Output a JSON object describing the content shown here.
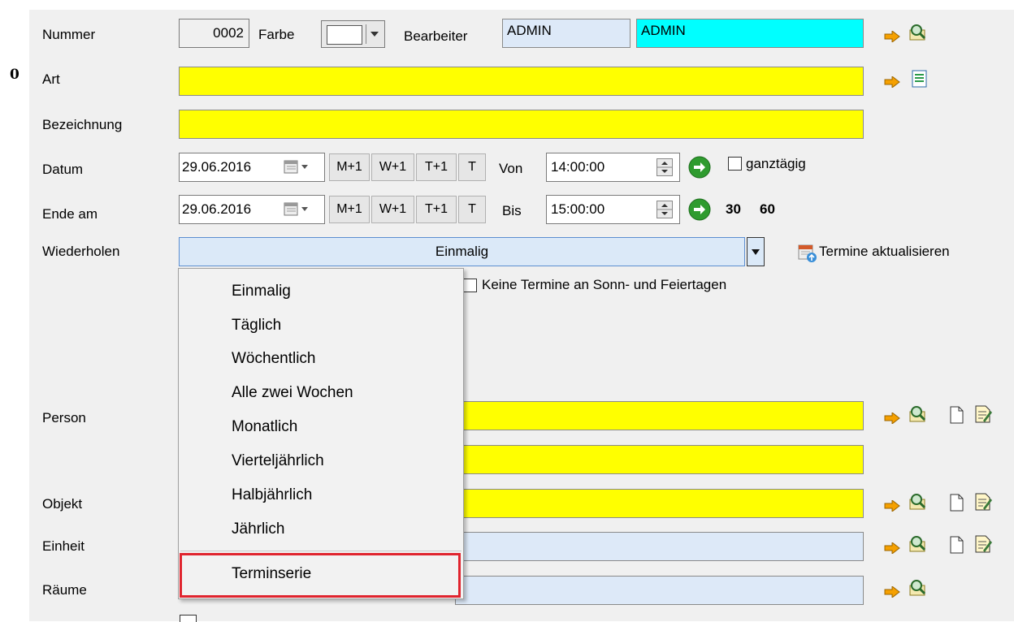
{
  "margin_marker": "0",
  "labels": {
    "nummer": "Nummer",
    "farbe": "Farbe",
    "bearbeiter": "Bearbeiter",
    "art": "Art",
    "bezeichnung": "Bezeichnung",
    "datum": "Datum",
    "ende_am": "Ende am",
    "wiederholen": "Wiederholen",
    "person": "Person",
    "objekt": "Objekt",
    "einheit": "Einheit",
    "raeume": "Räume",
    "von": "Von",
    "bis": "Bis"
  },
  "fields": {
    "nummer": "0002",
    "bearbeiter_code": "ADMIN",
    "bearbeiter_name": "ADMIN",
    "art": "",
    "bezeichnung": "",
    "datum": "29.06.2016",
    "ende_am": "29.06.2016",
    "von_time": "14:00:00",
    "bis_time": "15:00:00",
    "wiederholen": "Einmalig"
  },
  "date_buttons": [
    "M+1",
    "W+1",
    "T+1",
    "T"
  ],
  "ganztaegig_label": "ganztägig",
  "duration_30": "30",
  "duration_60": "60",
  "termine_aktualisieren": "Termine aktualisieren",
  "keine_termine_label": "Keine Termine an Sonn- und Feiertagen",
  "dropdown": {
    "items": [
      "Einmalig",
      "Täglich",
      "Wöchentlich",
      "Alle zwei Wochen",
      "Monatlich",
      "Vierteljährlich",
      "Halbjährlich",
      "Jährlich"
    ],
    "special_item": "Terminserie"
  },
  "colors": {
    "required_field": "#ffff00",
    "readonly_field": "#dde9f8",
    "bearbeiter_name_field": "#00ffff",
    "highlight_border": "#e0242e",
    "arrow_icon": "#f5a000"
  }
}
